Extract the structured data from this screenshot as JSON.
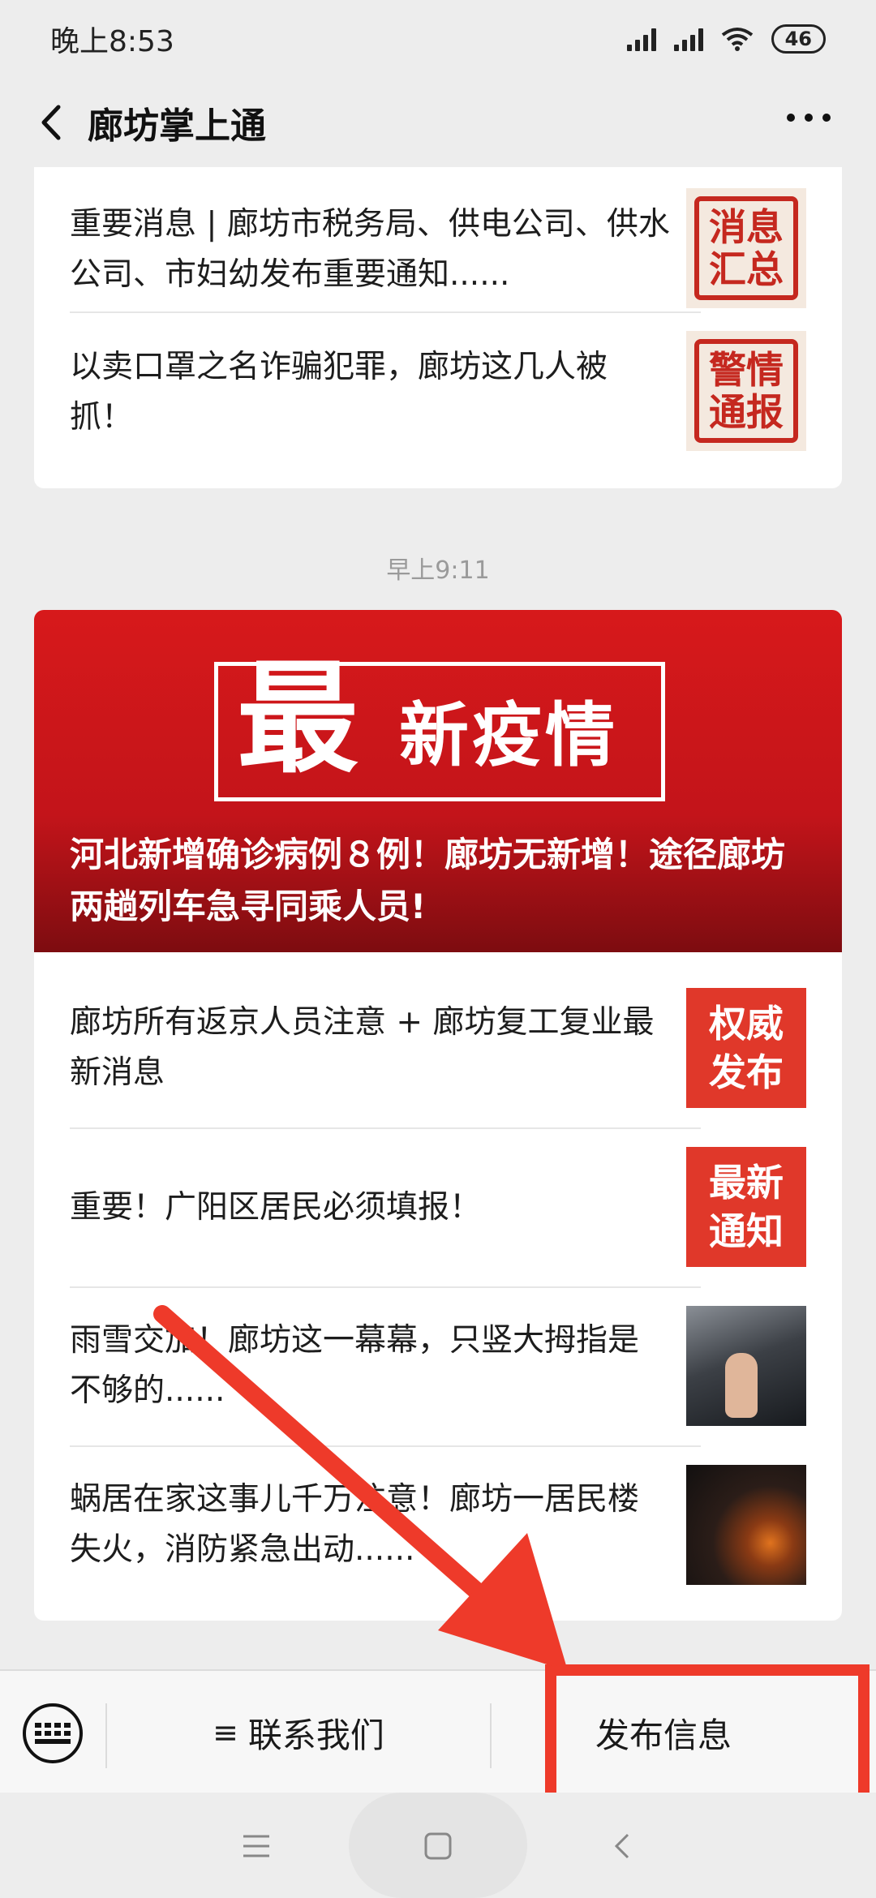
{
  "status_bar": {
    "time": "晚上8:53",
    "battery": "46"
  },
  "header": {
    "title": "廊坊掌上通"
  },
  "card1": {
    "items": [
      {
        "title": "重要消息 | 廊坊市税务局、供电公司、供水公司、市妇幼发布重要通知......",
        "thumb_text": "消息汇总"
      },
      {
        "title": "以卖口罩之名诈骗犯罪，廊坊这几人被抓！",
        "thumb_text": "警情通报"
      }
    ]
  },
  "time_label": "早上9:11",
  "card2": {
    "banner": {
      "big_char": "最",
      "sub_text": "新疫情",
      "headline": "河北新增确诊病例８例！廊坊无新增！途径廊坊两趟列车急寻同乘人员!"
    },
    "items": [
      {
        "title": "廊坊所有返京人员注意 + 廊坊复工复业最新消息",
        "thumb_text": "权威发布"
      },
      {
        "title": "重要！广阳区居民必须填报！",
        "thumb_text": "最新通知"
      },
      {
        "title": "雨雪交加！廊坊这一幕幕，只竖大拇指是不够的......"
      },
      {
        "title": "蜗居在家这事儿千万注意！廊坊一居民楼失火，消防紧急出动......"
      }
    ]
  },
  "menu": {
    "contact": "联系我们",
    "contact_prefix": "≡",
    "publish": "发布信息"
  },
  "colors": {
    "accent_red": "#ee3a2a",
    "banner_red": "#d7191b",
    "background": "#ededed"
  }
}
